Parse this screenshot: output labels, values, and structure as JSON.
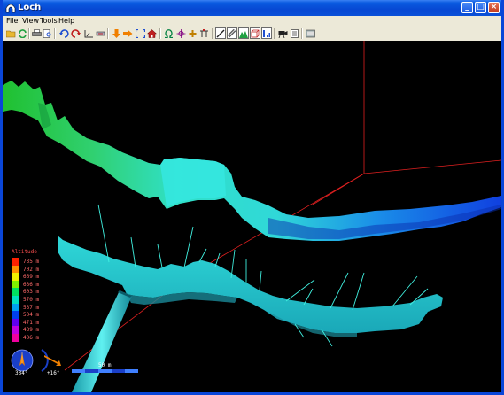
{
  "window": {
    "title": "Loch",
    "buttons": {
      "minimize": "_",
      "maximize": "□",
      "close": "×"
    }
  },
  "menu": {
    "items": [
      {
        "label": "File"
      },
      {
        "label": "View"
      },
      {
        "label": "Tools"
      },
      {
        "label": "Help"
      }
    ]
  },
  "toolbar": {
    "buttons": [
      {
        "icon": "open-folder-icon",
        "color": "#d8a020"
      },
      {
        "icon": "reload-icon",
        "color": "#20a040"
      },
      {
        "icon": "print-icon",
        "color": "#404040"
      },
      {
        "icon": "print-preview-icon",
        "color": "#404040"
      },
      {
        "icon": "rotate-left-icon",
        "color": "#2050d0"
      },
      {
        "icon": "rotate-right-icon",
        "color": "#c02020"
      },
      {
        "icon": "plan-view-icon",
        "color": "#404040"
      },
      {
        "icon": "elevation-view-icon",
        "color": "#404040"
      },
      {
        "icon": "move-down-icon",
        "color": "#f08000"
      },
      {
        "icon": "move-right-icon",
        "color": "#f08000"
      },
      {
        "icon": "zoom-extents-icon",
        "color": "#2050d0"
      },
      {
        "icon": "home-icon",
        "color": "#c02020"
      },
      {
        "icon": "omega-icon",
        "color": "#008040"
      },
      {
        "icon": "crosshair-icon",
        "color": "#800080"
      },
      {
        "icon": "plus-icon",
        "color": "#c08000"
      },
      {
        "icon": "entrance-icon",
        "color": "#404040"
      },
      {
        "icon": "centerline-icon",
        "color": "#202020",
        "pressed": true
      },
      {
        "icon": "tube-icon",
        "color": "#202020",
        "pressed": true
      },
      {
        "icon": "terrain-icon",
        "color": "#20a040",
        "pressed": true
      },
      {
        "icon": "bounding-box-icon",
        "color": "#c02020",
        "pressed": true
      },
      {
        "icon": "color-scale-icon",
        "color": "#2050d0",
        "pressed": true
      },
      {
        "icon": "camera-icon",
        "color": "#202020"
      },
      {
        "icon": "info-icon",
        "color": "#404040"
      },
      {
        "icon": "fullscreen-icon",
        "color": "#606060"
      }
    ]
  },
  "legend": {
    "title": "Altitude",
    "entries": [
      {
        "label": "735 m",
        "color": "#ff2000"
      },
      {
        "label": "702 m",
        "color": "#ff9000"
      },
      {
        "label": "669 m",
        "color": "#f0f000"
      },
      {
        "label": "636 m",
        "color": "#80f000"
      },
      {
        "label": "603 m",
        "color": "#00e060"
      },
      {
        "label": "570 m",
        "color": "#00e0c0"
      },
      {
        "label": "537 m",
        "color": "#00a0f0"
      },
      {
        "label": "504 m",
        "color": "#0040f0"
      },
      {
        "label": "471 m",
        "color": "#6000f0"
      },
      {
        "label": "439 m",
        "color": "#c000e0"
      },
      {
        "label": "406 m",
        "color": "#f000a0"
      }
    ]
  },
  "compass": {
    "heading": "334°"
  },
  "clino": {
    "tilt": "+16°"
  },
  "scale_bar": {
    "label": "50 m"
  },
  "colors": {
    "titlebar": "#0a50d8",
    "box_lines": "#ff2020",
    "cave_cyan": "#30e0e0",
    "cave_green": "#20d040",
    "cave_blue": "#1050e0"
  }
}
